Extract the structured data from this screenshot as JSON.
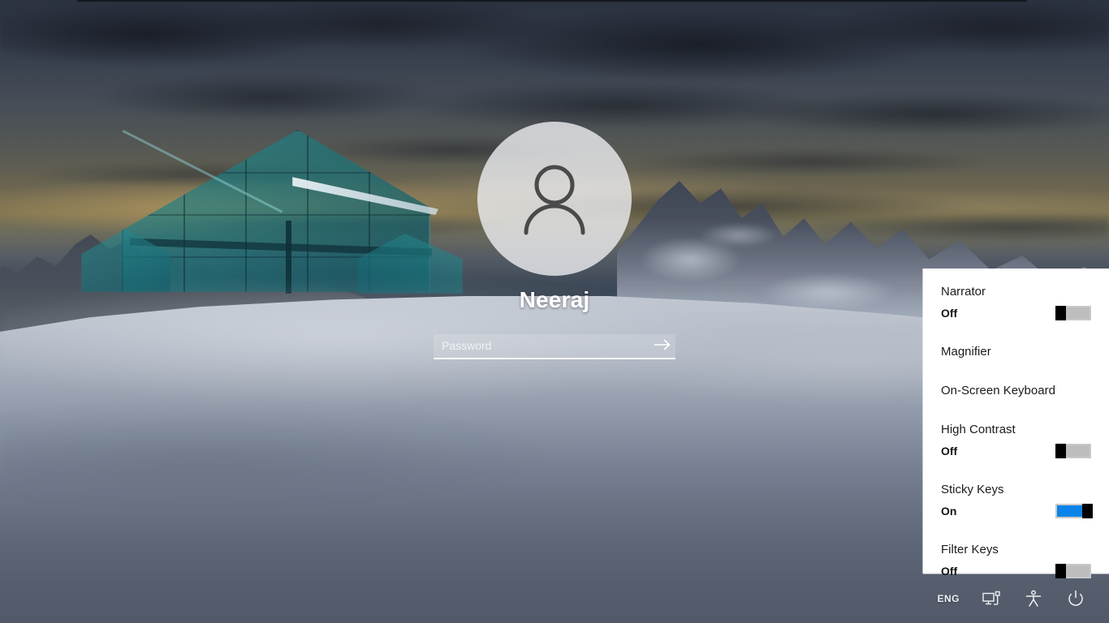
{
  "screen": {
    "type": "windows-lock-screen",
    "background_description": "Snow mountain landscape at dusk with teal glass greenhouse"
  },
  "login": {
    "avatar_icon": "user-avatar-icon",
    "user_name": "Neeraj",
    "password": {
      "value": "",
      "placeholder": "Password",
      "submit_icon": "arrow-right-icon"
    }
  },
  "ease_of_access_panel": {
    "accent_on_color": "#0a84e8",
    "background_color": "#ffffff",
    "items": [
      {
        "label": "Narrator",
        "state": "Off",
        "has_toggle": true,
        "on": false
      },
      {
        "label": "Magnifier",
        "state": "",
        "has_toggle": false,
        "on": false
      },
      {
        "label": "On-Screen Keyboard",
        "state": "",
        "has_toggle": false,
        "on": false
      },
      {
        "label": "High Contrast",
        "state": "Off",
        "has_toggle": true,
        "on": false
      },
      {
        "label": "Sticky Keys",
        "state": "On",
        "has_toggle": true,
        "on": true
      },
      {
        "label": "Filter Keys",
        "state": "Off",
        "has_toggle": true,
        "on": false
      }
    ]
  },
  "bottom_bar": {
    "language": "ENG",
    "icons": [
      {
        "name": "network-icon"
      },
      {
        "name": "ease-of-access-icon"
      },
      {
        "name": "power-icon"
      }
    ]
  }
}
